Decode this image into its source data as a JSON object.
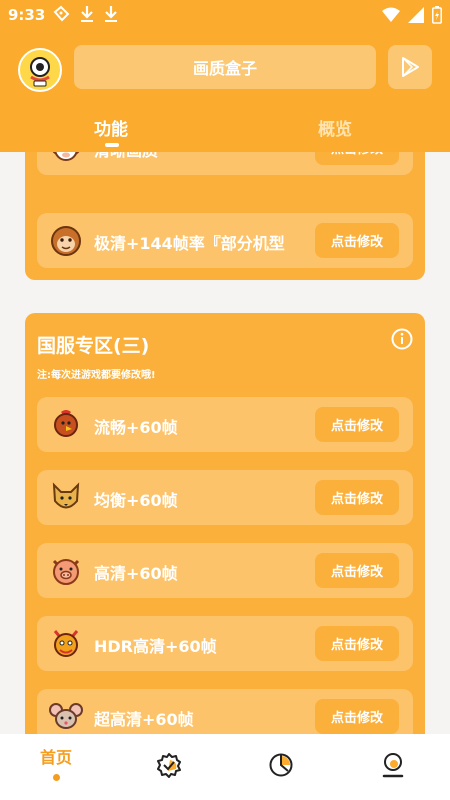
{
  "status_bar": {
    "time": "9:33",
    "left_icons": [
      "ticket-icon",
      "download-icon",
      "download-icon"
    ],
    "right_icons": [
      "wifi-icon",
      "signal-icon",
      "battery-charging-icon"
    ]
  },
  "header": {
    "title": "画质盒子",
    "tabs": [
      {
        "label": "功能",
        "active": true
      },
      {
        "label": "概览",
        "active": false
      }
    ]
  },
  "section1": {
    "items": [
      {
        "label": "清晰画质",
        "button": "点击修改",
        "icon": "ram-icon"
      },
      {
        "label": "极清+144帧率『部分机型",
        "button": "点击修改",
        "icon": "monkey-icon"
      }
    ]
  },
  "section2": {
    "title": "国服专区(三)",
    "note": "注:每次进游戏都要修改哦!",
    "items": [
      {
        "label": "流畅+60帧",
        "button": "点击修改",
        "icon": "rooster-icon"
      },
      {
        "label": "均衡+60帧",
        "button": "点击修改",
        "icon": "dog-icon"
      },
      {
        "label": "高清+60帧",
        "button": "点击修改",
        "icon": "pig-icon"
      },
      {
        "label": "HDR高清+60帧",
        "button": "点击修改",
        "icon": "dragon-icon"
      },
      {
        "label": "超高清+60帧",
        "button": "点击修改",
        "icon": "rat-icon"
      }
    ]
  },
  "bottom_nav": {
    "home_label": "首页",
    "icons": [
      "home-icon",
      "badge-check-icon",
      "pie-chart-icon",
      "profile-icon"
    ]
  },
  "colors": {
    "primary": "#fbab2e",
    "card": "#fbb03c",
    "row": "#fcc36a",
    "accent": "#f59d1e"
  }
}
